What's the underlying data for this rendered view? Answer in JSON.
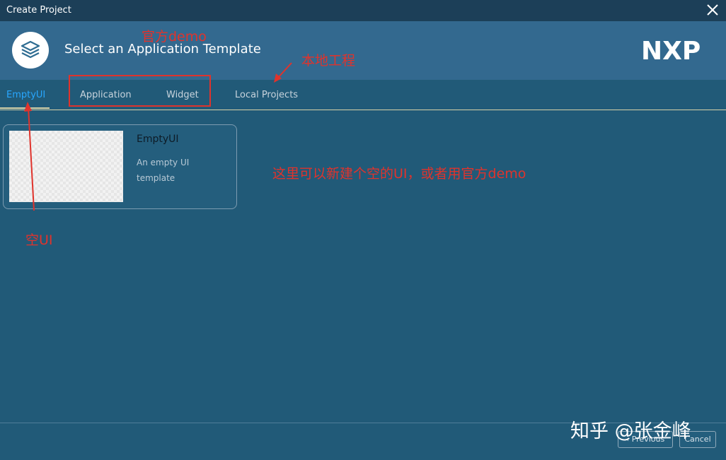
{
  "window": {
    "title": "Create Project",
    "close_icon": "close-icon"
  },
  "header": {
    "logo_icon": "layers-icon",
    "heading": "Select an Application Template",
    "brand": "NXP"
  },
  "tabs": [
    {
      "label": "EmptyUI",
      "active": true
    },
    {
      "label": "Application",
      "active": false
    },
    {
      "label": "Widget",
      "active": false
    },
    {
      "label": "Local Projects",
      "active": false
    }
  ],
  "templates": [
    {
      "name": "EmptyUI",
      "description": "An empty UI template"
    }
  ],
  "footer": {
    "previous_label": "Previous",
    "cancel_label": "Cancel"
  },
  "annotations": {
    "official_demo": "官方demo",
    "local_project": "本地工程",
    "empty_ui": "空UI",
    "note": "这里可以新建个空的UI，或者用官方demo"
  },
  "watermark": "知乎 @张金峰",
  "colors": {
    "titlebar": "#1c3f58",
    "header": "#33698f",
    "background": "#215a78",
    "active_tab": "#28a7ff",
    "annotation": "#e0332c"
  }
}
